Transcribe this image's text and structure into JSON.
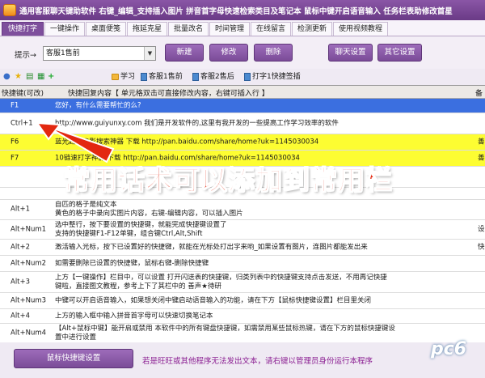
{
  "app": {
    "title": "通用客服聊天键助软件   右键_编辑_支持插入图片   拼音首字母快速检索类目及笔记本   鼠标中键开启语音输入   任务栏表助修改首星"
  },
  "tabs": [
    "快捷打字",
    "一键操作",
    "桌面便笺",
    "拖延克星",
    "批量改名",
    "时间管理",
    "在线留言",
    "检测更新",
    "使用视频教程"
  ],
  "toolbar": {
    "prompt_label": "提示→",
    "combo_value": "客服1售前",
    "new_label": "新建",
    "edit_label": "修改",
    "delete_label": "删除",
    "chat_settings_label": "聊天设置",
    "other_settings_label": "其它设置"
  },
  "quickbar": {
    "folders": [
      "学习",
      "客服1售前",
      "客服2售后",
      "打字1快捷签插"
    ]
  },
  "grid": {
    "headers": [
      "快捷键(可改)",
      "快捷回复内容【 单元格双击可直接修改内容，右键可插入行 】",
      "备"
    ],
    "rows": [
      {
        "key": "F1",
        "content": "您好，有什么需要帮忙的么?",
        "extra": ""
      },
      {
        "key": "Ctrl+1",
        "content": "http://www.guiyunxy.com   我们是开发软件的,这里有我开发的一些提高工作学习效率的软件",
        "extra": ""
      },
      {
        "key": "F6",
        "content": "蓝光超清电影搜索神器 下载 http://pan.baidu.com/share/home?uk=1145030034",
        "extra": "善"
      },
      {
        "key": "F7",
        "content": "10链速打字神器 下载 http://pan.baidu.com/share/home?uk=1145030034",
        "extra": "善"
      },
      {
        "key": "",
        "content": "",
        "extra": ""
      },
      {
        "key": "",
        "content": "",
        "extra": ""
      },
      {
        "key": "Alt+1",
        "content": "自匹的格子是纯文本\n黄色的格子中录向实图片内容，右键-编辑内容，可以插入图片",
        "extra": ""
      },
      {
        "key": "Alt+Num1",
        "content": "选中整行，按下要设置的快捷键，就能完成快捷键设置了\n支持的快捷键F1-F12单键，组合键Ctrl,Alt,Shift",
        "extra": "设"
      },
      {
        "key": "Alt+2",
        "content": "激活输入光标，按下已设置好的快捷键，就能在光标处打出字来哟_如果设置有图片，连图片都能发出来",
        "extra": "快"
      },
      {
        "key": "Alt+Num2",
        "content": "如需要删除已设置的快捷键，鼠标右键-删除快捷键",
        "extra": ""
      },
      {
        "key": "Alt+3",
        "content": "上方【一键操作】栏目中，可以设置 打开闪送表的快捷键，归类列表中的快捷键支持点击发送，不用再记快捷\n键啦，直接图文教程，参考上下了其栏中的 善声★待研",
        "extra": ""
      },
      {
        "key": "Alt+Num3",
        "content": "中键可以开启语音输入，如果想关闭中键启动语音输入的功能，请在下方【鼠标快捷键设置】栏目里关闭",
        "extra": ""
      },
      {
        "key": "Alt+4",
        "content": "上方的输入框中输入拼音首字母可以快速切换笔记本",
        "extra": ""
      },
      {
        "key": "Alt+Num4",
        "content": "【Alt+鼠标中键】能开启或禁用 本软件中的所有键盘快捷键，如需禁用某些鼠标热键，请在下方的鼠标快捷键设\n置中进行设置",
        "extra": ""
      }
    ]
  },
  "overlay_text": "常用话术可以添加到常用栏",
  "footer": {
    "button_label": "鼠标快捷键设置",
    "note": "若是旺旺或其他程序无法发出文本，请右键以管理员身份运行本程序"
  },
  "watermark": "pc6"
}
